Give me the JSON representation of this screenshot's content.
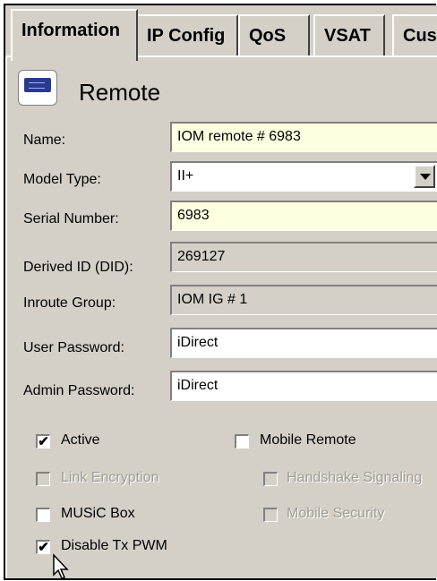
{
  "tabs": [
    {
      "label": "Information",
      "active": true
    },
    {
      "label": "IP Config",
      "active": false
    },
    {
      "label": "QoS",
      "active": false
    },
    {
      "label": "VSAT",
      "active": false
    },
    {
      "label": "Cus",
      "active": false
    }
  ],
  "section": {
    "title": "Remote",
    "icon": "remote-modem-icon"
  },
  "fields": {
    "name": {
      "label": "Name:",
      "value": "IOM remote # 6983"
    },
    "model_type": {
      "label": "Model Type:",
      "value": "II+"
    },
    "serial_number": {
      "label": "Serial Number:",
      "value": "6983"
    },
    "derived_id": {
      "label": "Derived ID (DID):",
      "value": "269127"
    },
    "inroute_group": {
      "label": "Inroute Group:",
      "value": "IOM IG # 1"
    },
    "user_password": {
      "label": "User Password:",
      "value": "iDirect"
    },
    "admin_password": {
      "label": "Admin Password:",
      "value": "iDirect"
    }
  },
  "checkboxes": {
    "active": {
      "label": "Active",
      "checked": true,
      "enabled": true
    },
    "mobile_remote": {
      "label": "Mobile Remote",
      "checked": false,
      "enabled": true
    },
    "link_encryption": {
      "label": "Link Encryption",
      "checked": false,
      "enabled": false
    },
    "handshake_signaling": {
      "label": "Handshake Signaling",
      "checked": false,
      "enabled": false
    },
    "music_box": {
      "label": "MUSiC Box",
      "checked": false,
      "enabled": true
    },
    "mobile_security": {
      "label": "Mobile Security",
      "checked": false,
      "enabled": false
    },
    "disable_tx_pwm": {
      "label": "Disable Tx PWM",
      "checked": true,
      "enabled": true
    }
  },
  "check_glyph": "✔",
  "colors": {
    "panel": "#d4d0c8",
    "highlight_field": "#ffffe1",
    "disabled_text": "#a09c94"
  }
}
